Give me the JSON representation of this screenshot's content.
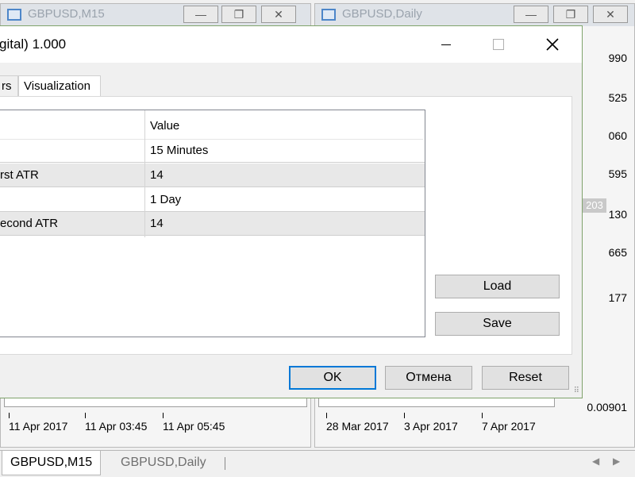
{
  "background": {
    "left_window": {
      "title": "GBPUSD,M15",
      "buttons": [
        "—",
        "❐",
        "✕"
      ],
      "xaxis": [
        "11 Apr 2017",
        "11 Apr 03:45",
        "11 Apr 05:45"
      ]
    },
    "right_window": {
      "title": "GBPUSD,Daily",
      "buttons": [
        "—",
        "❐",
        "✕"
      ],
      "xaxis": [
        "28 Mar 2017",
        "3 Apr 2017",
        "7 Apr 2017"
      ],
      "prices": [
        "990",
        "525",
        "060",
        "595",
        "130",
        "665",
        "177",
        "0.00901"
      ],
      "price_tag": "203"
    }
  },
  "dialog": {
    "title": "gital) 1.000",
    "tabs": [
      "rs",
      "Visualization"
    ],
    "grid": {
      "header_value": "Value",
      "rows": [
        {
          "name": "",
          "value": "15 Minutes"
        },
        {
          "name": "rst ATR",
          "value": "14"
        },
        {
          "name": "",
          "value": "1 Day"
        },
        {
          "name": "econd ATR",
          "value": "14"
        }
      ]
    },
    "buttons": {
      "load": "Load",
      "save": "Save",
      "ok": "OK",
      "cancel": "Отмена",
      "reset": "Reset"
    }
  },
  "tabbar": {
    "tabs": [
      "GBPUSD,M15",
      "GBPUSD,Daily"
    ],
    "active_index": 0
  },
  "colors": {
    "accent": "#0078d7",
    "dialog_border": "#7fa36b"
  }
}
